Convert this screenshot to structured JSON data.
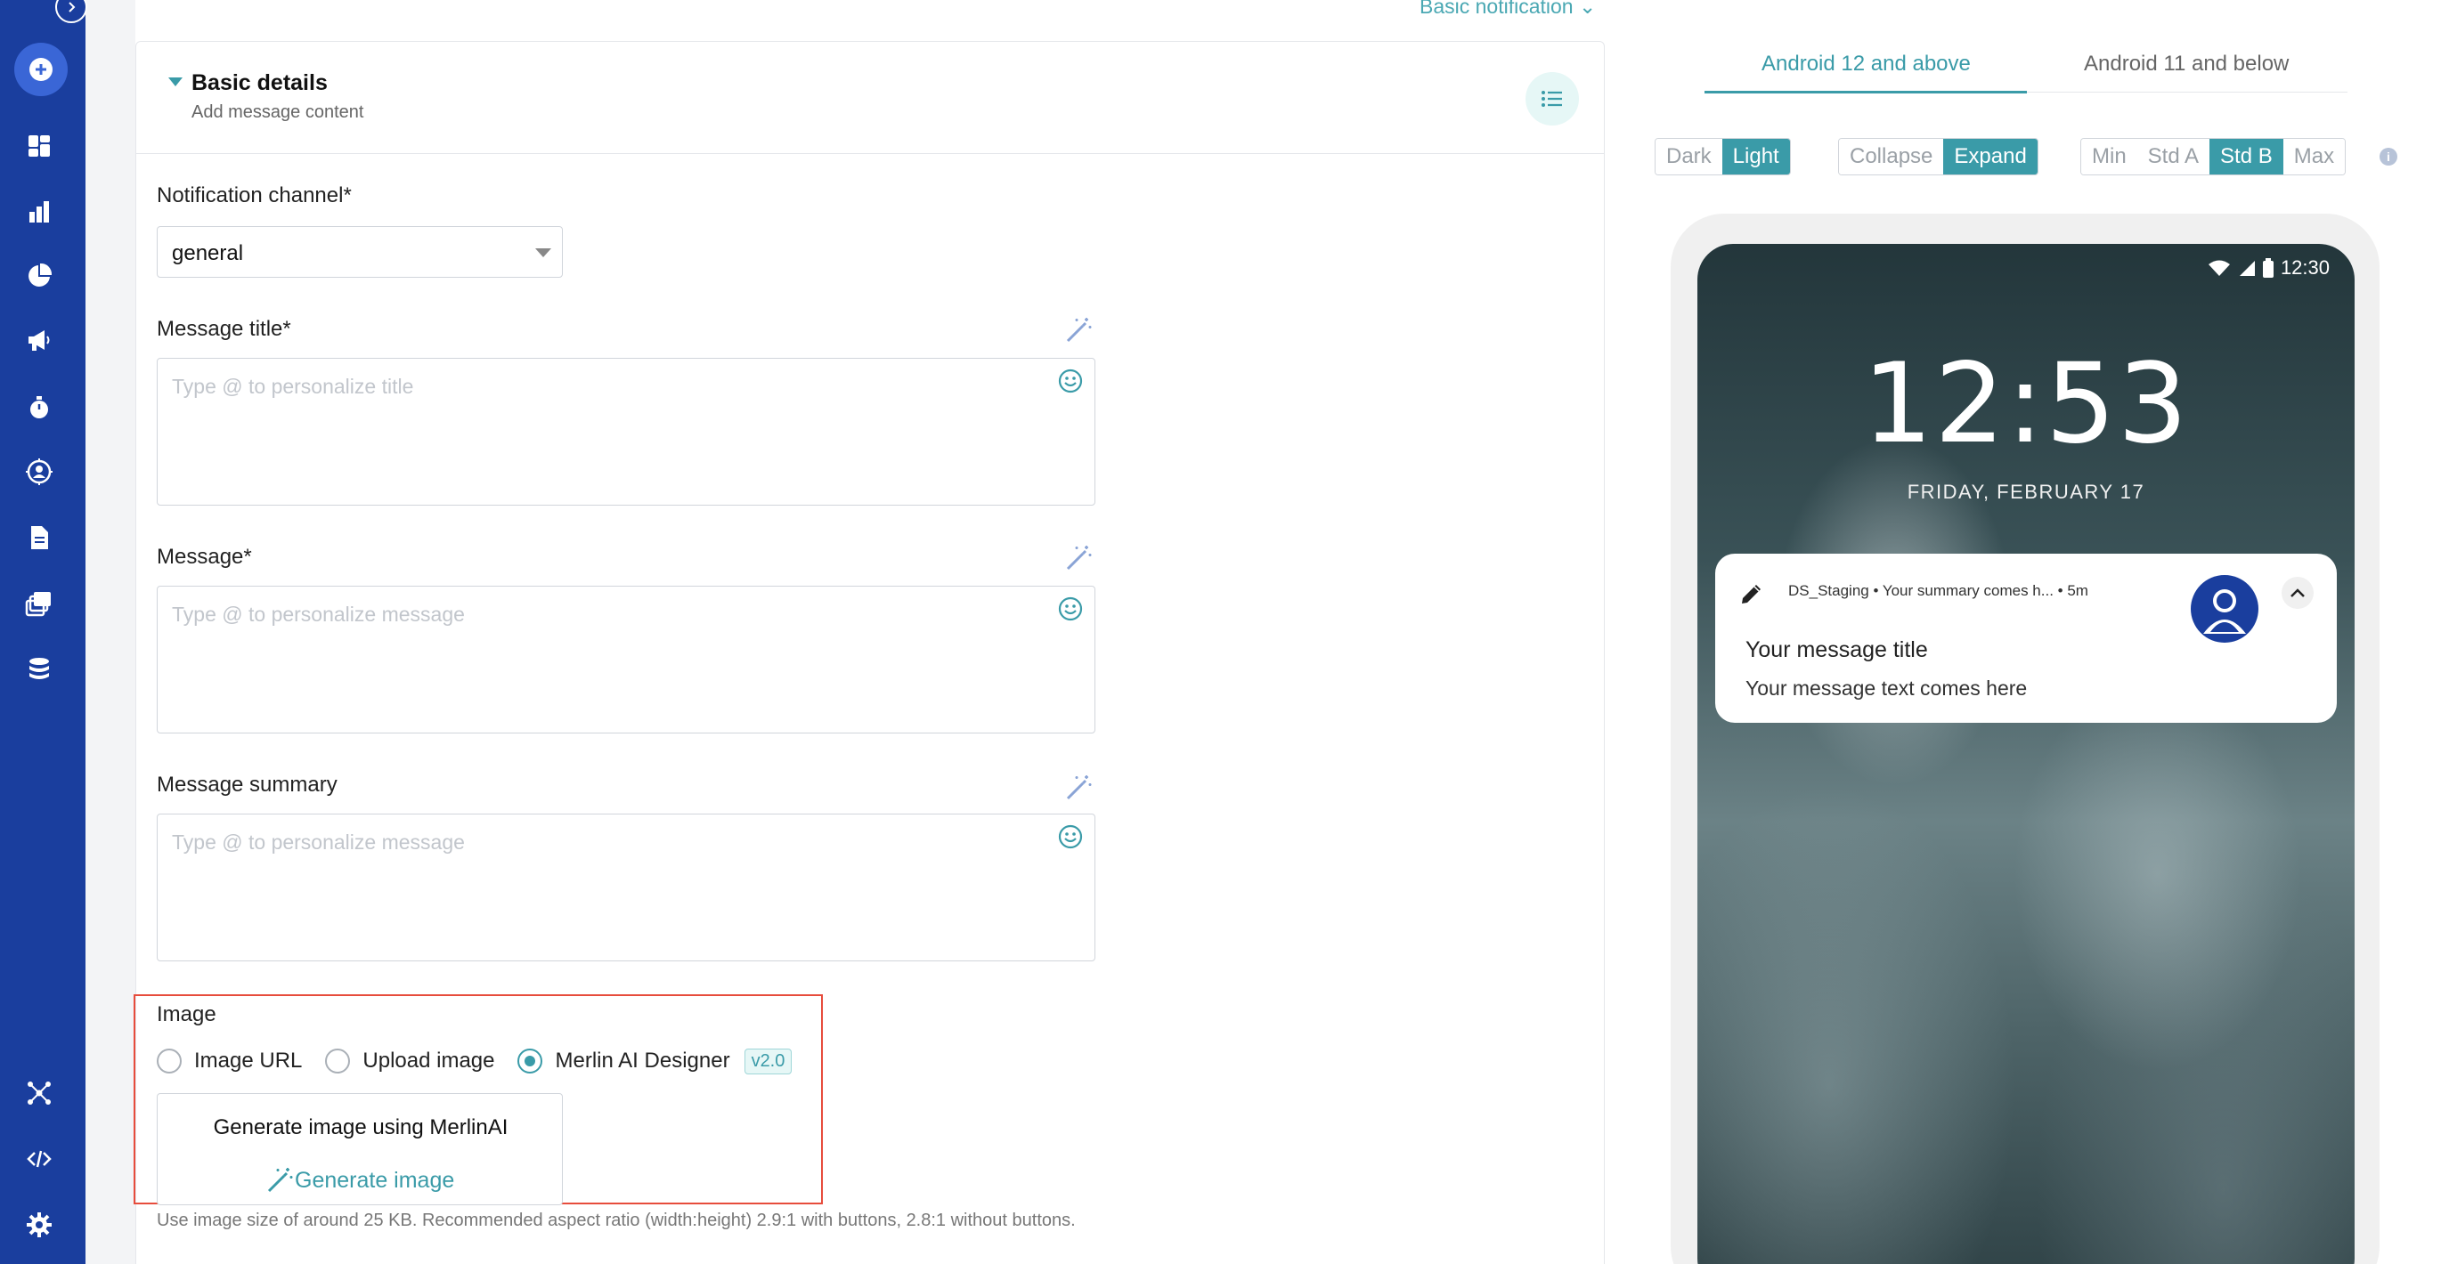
{
  "header": {
    "notification_type_link": "Basic notification"
  },
  "section": {
    "title": "Basic details",
    "subtitle": "Add message content"
  },
  "fields": {
    "channel": {
      "label": "Notification channel*",
      "value": "general"
    },
    "title": {
      "label": "Message title*",
      "placeholder": "Type @ to personalize title"
    },
    "message": {
      "label": "Message*",
      "placeholder": "Type @ to personalize message"
    },
    "summary": {
      "label": "Message summary",
      "placeholder": "Type @ to personalize message"
    }
  },
  "image": {
    "label": "Image",
    "options": [
      "Image URL",
      "Upload image",
      "Merlin AI Designer"
    ],
    "selected": "Merlin AI Designer",
    "version_badge": "v2.0",
    "generate_title": "Generate image using MerlinAI",
    "generate_link": "Generate image",
    "hint": "Use image size of around 25 KB. Recommended aspect ratio (width:height) 2.9:1 with buttons, 2.8:1 without buttons."
  },
  "preview": {
    "tabs": [
      "Android 12 and above",
      "Android 11 and below"
    ],
    "active_tab": "Android 12 and above",
    "theme": {
      "options": [
        "Dark",
        "Light"
      ],
      "selected": "Light"
    },
    "state": {
      "options": [
        "Collapse",
        "Expand"
      ],
      "selected": "Expand"
    },
    "style": {
      "options": [
        "Min",
        "Std A",
        "Std B",
        "Max"
      ],
      "selected": "Std B"
    },
    "status_time": "12:30",
    "clock": "12:53",
    "date": "FRIDAY, FEBRUARY 17",
    "notification": {
      "meta": "DS_Staging • Your summary comes h...  • 5m",
      "title": "Your message title",
      "text": "Your message text comes here"
    }
  },
  "colors": {
    "sidebar": "#1a3e9e",
    "accent": "#3a9ba8",
    "highlight_border": "#e74c3c"
  }
}
